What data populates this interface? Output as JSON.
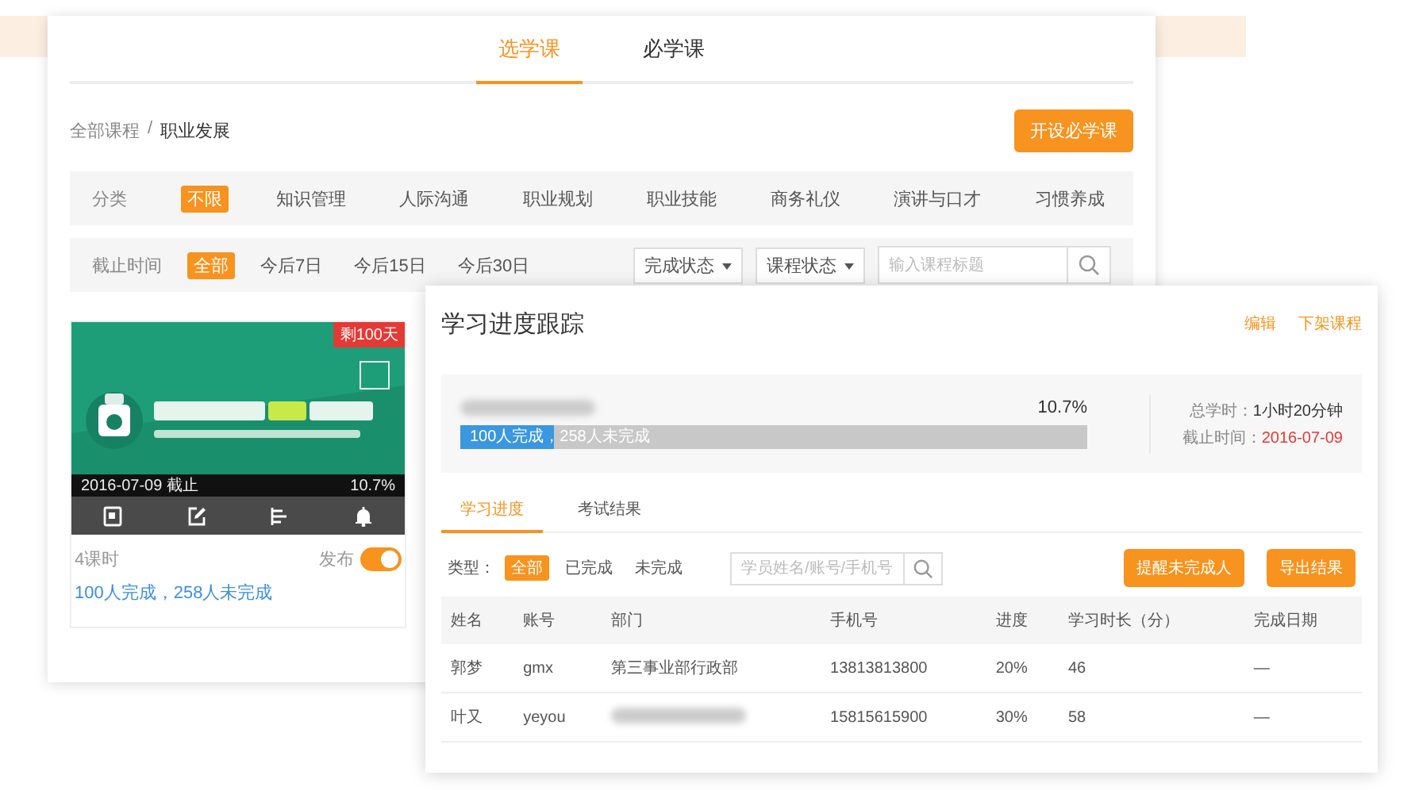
{
  "main_window": {
    "tabs": [
      {
        "label": "选学课",
        "selected": true
      },
      {
        "label": "必学课",
        "selected": false
      }
    ],
    "breadcrumb": [
      "全部课程",
      "/",
      "职业发展"
    ],
    "create_button": "开设必学课",
    "category_filter": {
      "label": "分类",
      "options": [
        {
          "label": "不限",
          "selected": true
        },
        {
          "label": "知识管理",
          "selected": false
        },
        {
          "label": "人际沟通",
          "selected": false
        },
        {
          "label": "职业规划",
          "selected": false
        },
        {
          "label": "职业技能",
          "selected": false
        },
        {
          "label": "商务礼仪",
          "selected": false
        },
        {
          "label": "演讲与口才",
          "selected": false
        },
        {
          "label": "习惯养成",
          "selected": false
        }
      ]
    },
    "deadline_filter": {
      "label": "截止时间",
      "options": [
        {
          "label": "全部",
          "selected": true
        },
        {
          "label": "今后7日",
          "selected": false
        },
        {
          "label": "今后15日",
          "selected": false
        },
        {
          "label": "今后30日",
          "selected": false
        }
      ]
    },
    "dropdowns": [
      "完成状态",
      "课程状态"
    ],
    "search": {
      "placeholder": "输入课程标题"
    },
    "course_card": {
      "badge": "剩100天",
      "deadline": "2016-07-09 截止",
      "progress": "10.7%",
      "lessons": "4课时",
      "publish_label": "发布",
      "published": true,
      "summary": "100人完成，258人未完成"
    }
  },
  "progress_window": {
    "title": "学习进度跟踪",
    "links": [
      "编辑",
      "下架课程"
    ],
    "summary": {
      "name_blurred": true,
      "percent": "10.7%",
      "level": 0.15,
      "bar_text": "100人完成，258人未完成",
      "total_hours_label": "总学时：",
      "total_hours": "1小时20分钟",
      "deadline_label": "截止时间：",
      "deadline": "2016-07-09"
    },
    "tabs": [
      {
        "label": "学习进度",
        "selected": true
      },
      {
        "label": "考试结果",
        "selected": false
      }
    ],
    "type_filter": {
      "label": "类型：",
      "options": [
        {
          "label": "全部",
          "selected": true
        },
        {
          "label": "已完成",
          "selected": false
        },
        {
          "label": "未完成",
          "selected": false
        }
      ]
    },
    "search": {
      "placeholder": "学员姓名/账号/手机号"
    },
    "buttons": [
      "提醒未完成人",
      "导出结果"
    ],
    "table": {
      "columns": [
        "姓名",
        "账号",
        "部门",
        "手机号",
        "进度",
        "学习时长（分）",
        "完成日期"
      ],
      "rows": [
        {
          "name": "郭梦",
          "account": "gmx",
          "department": "第三事业部行政部",
          "department_blurred": false,
          "phone": "13813813800",
          "progress": "20%",
          "minutes": "46",
          "completed": "—"
        },
        {
          "name": "叶又",
          "account": "yeyou",
          "department_blurred": true,
          "phone": "15815615900",
          "progress": "30%",
          "minutes": "58",
          "completed": "—"
        }
      ]
    }
  }
}
